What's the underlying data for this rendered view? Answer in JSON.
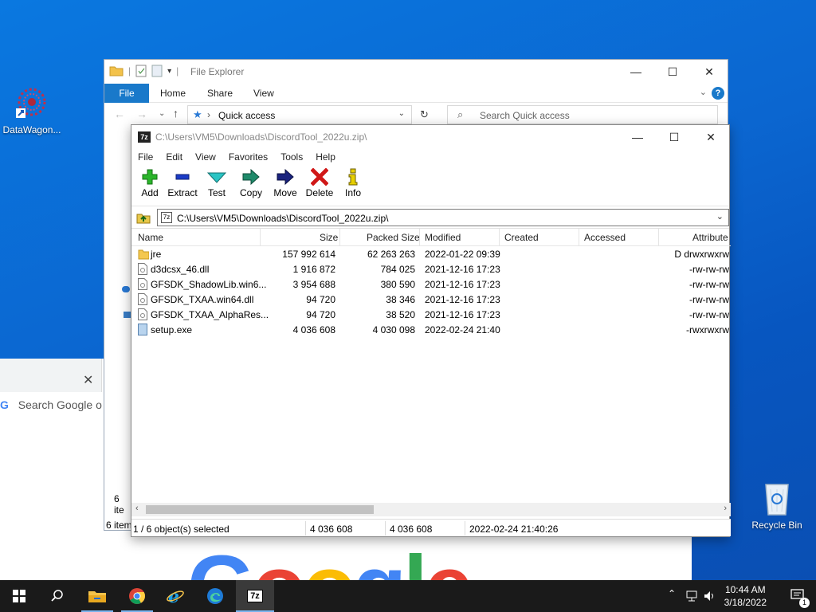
{
  "desktop": {
    "icons": [
      {
        "label": "DataWagon..."
      },
      {
        "label": "Recycle Bin"
      }
    ]
  },
  "chrome": {
    "omnibox_placeholder": "Search Google or",
    "close_glyph": "✕",
    "logo_text": "Google"
  },
  "explorer": {
    "title": "File Explorer",
    "ribbon_tabs": [
      "File",
      "Home",
      "Share",
      "View"
    ],
    "address": "Quick access",
    "search_placeholder": "Search Quick access",
    "status_items_partial": "6 ite",
    "status_items": "6 item"
  },
  "sevenzip": {
    "title": "C:\\Users\\VM5\\Downloads\\DiscordTool_2022u.zip\\",
    "menu": [
      "File",
      "Edit",
      "View",
      "Favorites",
      "Tools",
      "Help"
    ],
    "toolbar": [
      {
        "label": "Add",
        "icon": "plus-icon"
      },
      {
        "label": "Extract",
        "icon": "minus-icon"
      },
      {
        "label": "Test",
        "icon": "check-icon"
      },
      {
        "label": "Copy",
        "icon": "copy-arrow-icon"
      },
      {
        "label": "Move",
        "icon": "move-arrow-icon"
      },
      {
        "label": "Delete",
        "icon": "delete-x-icon"
      },
      {
        "label": "Info",
        "icon": "info-icon"
      }
    ],
    "path": "C:\\Users\\VM5\\Downloads\\DiscordTool_2022u.zip\\",
    "columns": [
      "Name",
      "Size",
      "Packed Size",
      "Modified",
      "Created",
      "Accessed",
      "Attribute"
    ],
    "rows": [
      {
        "name": "jre",
        "type": "folder",
        "size": "157 992 614",
        "packed": "62 263 263",
        "modified": "2022-01-22 09:39",
        "attr": "D drwxrwxrw"
      },
      {
        "name": "d3dcsx_46.dll",
        "type": "file",
        "size": "1 916 872",
        "packed": "784 025",
        "modified": "2021-12-16 17:23",
        "attr": "-rw-rw-rw"
      },
      {
        "name": "GFSDK_ShadowLib.win6...",
        "type": "file",
        "size": "3 954 688",
        "packed": "380 590",
        "modified": "2021-12-16 17:23",
        "attr": "-rw-rw-rw"
      },
      {
        "name": "GFSDK_TXAA.win64.dll",
        "type": "file",
        "size": "94 720",
        "packed": "38 346",
        "modified": "2021-12-16 17:23",
        "attr": "-rw-rw-rw"
      },
      {
        "name": "GFSDK_TXAA_AlphaRes...",
        "type": "file",
        "size": "94 720",
        "packed": "38 520",
        "modified": "2021-12-16 17:23",
        "attr": "-rw-rw-rw"
      },
      {
        "name": "setup.exe",
        "type": "exe",
        "size": "4 036 608",
        "packed": "4 030 098",
        "modified": "2022-02-24 21:40",
        "attr": "-rwxrwxrw"
      }
    ],
    "status": {
      "selection": "1 / 6 object(s) selected",
      "size": "4 036 608",
      "packed": "4 036 608",
      "modified": "2022-02-24 21:40:26"
    }
  },
  "taskbar": {
    "apps": [
      "start-icon",
      "search-icon",
      "file-explorer-icon",
      "chrome-icon",
      "internet-explorer-icon",
      "edge-icon",
      "7zip-icon"
    ],
    "sevenzip_label": "7z",
    "time": "10:44 AM",
    "date": "3/18/2022",
    "notification_count": "1"
  }
}
